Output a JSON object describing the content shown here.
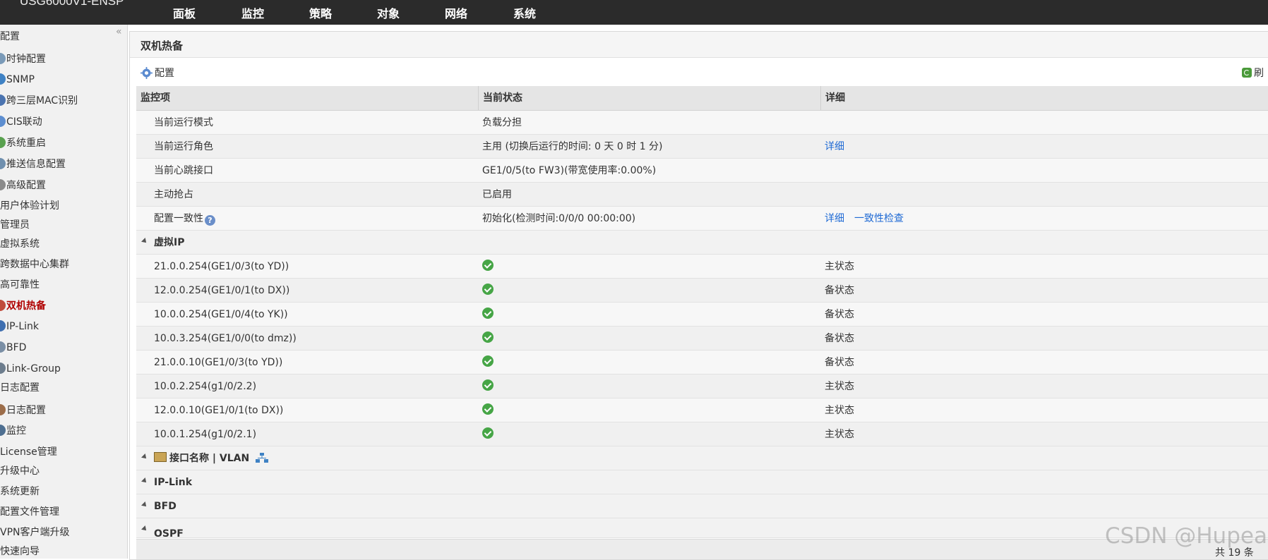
{
  "app": {
    "brand": "USG6000V1-ENSP"
  },
  "nav": [
    {
      "label": "面板"
    },
    {
      "label": "监控"
    },
    {
      "label": "策略"
    },
    {
      "label": "对象"
    },
    {
      "label": "网络"
    },
    {
      "label": "系统"
    }
  ],
  "sidebar": {
    "items": [
      {
        "label": "配置",
        "icon": ""
      },
      {
        "label": "时钟配置",
        "icon": "clock-icon"
      },
      {
        "label": "SNMP",
        "icon": "snmp-icon"
      },
      {
        "label": "跨三层MAC识别",
        "icon": "mac-icon"
      },
      {
        "label": "CIS联动",
        "icon": "cis-icon"
      },
      {
        "label": "系统重启",
        "icon": "reboot-icon"
      },
      {
        "label": "推送信息配置",
        "icon": "push-icon"
      },
      {
        "label": "高级配置",
        "icon": "advanced-icon"
      },
      {
        "label": "用户体验计划",
        "icon": ""
      },
      {
        "label": "管理员",
        "icon": ""
      },
      {
        "label": "虚拟系统",
        "icon": ""
      },
      {
        "label": "跨数据中心集群",
        "icon": ""
      },
      {
        "label": "高可靠性",
        "icon": ""
      },
      {
        "label": "双机热备",
        "icon": "ha-icon"
      },
      {
        "label": "IP-Link",
        "icon": "iplink-icon"
      },
      {
        "label": "BFD",
        "icon": "bfd-icon"
      },
      {
        "label": "Link-Group",
        "icon": "linkgroup-icon"
      },
      {
        "label": "日志配置",
        "icon": ""
      },
      {
        "label": "日志配置",
        "icon": "log-icon"
      },
      {
        "label": "监控",
        "icon": "monitor-icon"
      },
      {
        "label": "License管理",
        "icon": ""
      },
      {
        "label": "升级中心",
        "icon": ""
      },
      {
        "label": "系统更新",
        "icon": ""
      },
      {
        "label": "配置文件管理",
        "icon": ""
      },
      {
        "label": "VPN客户端升级",
        "icon": ""
      },
      {
        "label": "快速向导",
        "icon": ""
      }
    ]
  },
  "panel": {
    "title": "双机热备",
    "config_label": "配置",
    "refresh_label": "刷"
  },
  "table": {
    "headers": [
      "监控项",
      "当前状态",
      "详细"
    ],
    "rows": [
      {
        "item": "当前运行模式",
        "status": "负载分担",
        "detail": ""
      },
      {
        "item": "当前运行角色",
        "status": "主用 (切换后运行的时间: 0 天 0 时 1 分)",
        "detail": "详细"
      },
      {
        "item": "当前心跳接口",
        "status": "GE1/0/5(to FW3)(带宽使用率:0.00%)",
        "detail": ""
      },
      {
        "item": "主动抢占",
        "status": "已启用",
        "detail": ""
      },
      {
        "item": "配置一致性",
        "status": "初始化(检测时间:0/0/0 00:00:00)",
        "detail": "详细",
        "detail2": "一致性检查"
      }
    ],
    "virtual_ip_group": "虚拟IP",
    "vip_rows": [
      {
        "ip": "21.0.0.254(GE1/0/3(to YD))",
        "detail": "主状态"
      },
      {
        "ip": "12.0.0.254(GE1/0/1(to DX))",
        "detail": "备状态"
      },
      {
        "ip": "10.0.0.254(GE1/0/4(to YK))",
        "detail": "备状态"
      },
      {
        "ip": "10.0.3.254(GE1/0/0(to dmz))",
        "detail": "备状态"
      },
      {
        "ip": "21.0.0.10(GE1/0/3(to YD))",
        "detail": "备状态"
      },
      {
        "ip": "10.0.2.254(g1/0/2.2)",
        "detail": "主状态"
      },
      {
        "ip": "12.0.0.10(GE1/0/1(to DX))",
        "detail": "主状态"
      },
      {
        "ip": "10.0.1.254(g1/0/2.1)",
        "detail": "主状态"
      }
    ],
    "groups": [
      "接口名称 | VLAN",
      "IP-Link",
      "BFD",
      "OSPF"
    ],
    "total": "共 19 条"
  },
  "watermark": "CSDN @Hupea"
}
